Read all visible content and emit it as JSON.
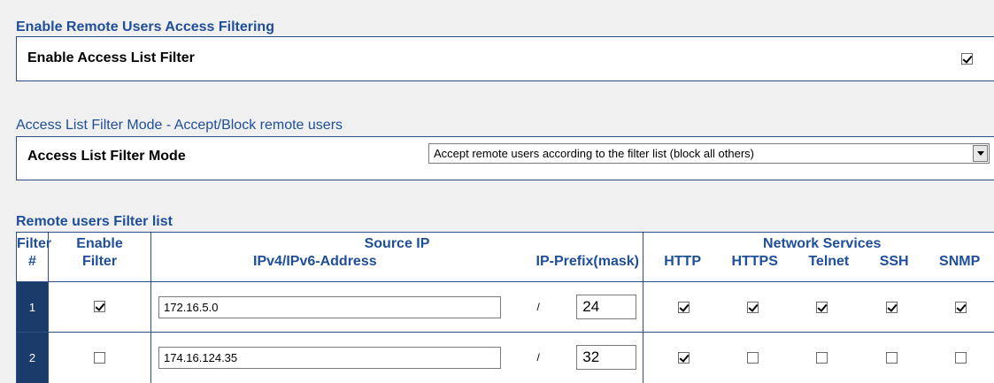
{
  "section1": {
    "title": "Enable Remote Users Access Filtering",
    "label": "Enable Access List Filter",
    "checked": true
  },
  "section2": {
    "title": "Access List Filter Mode - Accept/Block remote users",
    "label": "Access List Filter Mode",
    "selected": "Accept remote users according to the filter list (block all others)"
  },
  "section3": {
    "title": "Remote users Filter list",
    "headers": {
      "filter_line1": "Filter",
      "filter_line2": "#",
      "enable_line1": "Enable",
      "enable_line2": "Filter",
      "source_ip": "Source IP",
      "address": "IPv4/IPv6-Address",
      "prefix": "IP-Prefix(mask)",
      "network_services": "Network Services",
      "services": [
        "HTTP",
        "HTTPS",
        "Telnet",
        "SSH",
        "SNMP"
      ]
    },
    "separator": "/",
    "rows": [
      {
        "num": "1",
        "enabled": true,
        "address": "172.16.5.0",
        "mask": "24",
        "http": true,
        "https": true,
        "telnet": true,
        "ssh": true,
        "snmp": true
      },
      {
        "num": "2",
        "enabled": false,
        "address": "174.16.124.35",
        "mask": "32",
        "http": true,
        "https": false,
        "telnet": false,
        "ssh": false,
        "snmp": false
      }
    ]
  }
}
